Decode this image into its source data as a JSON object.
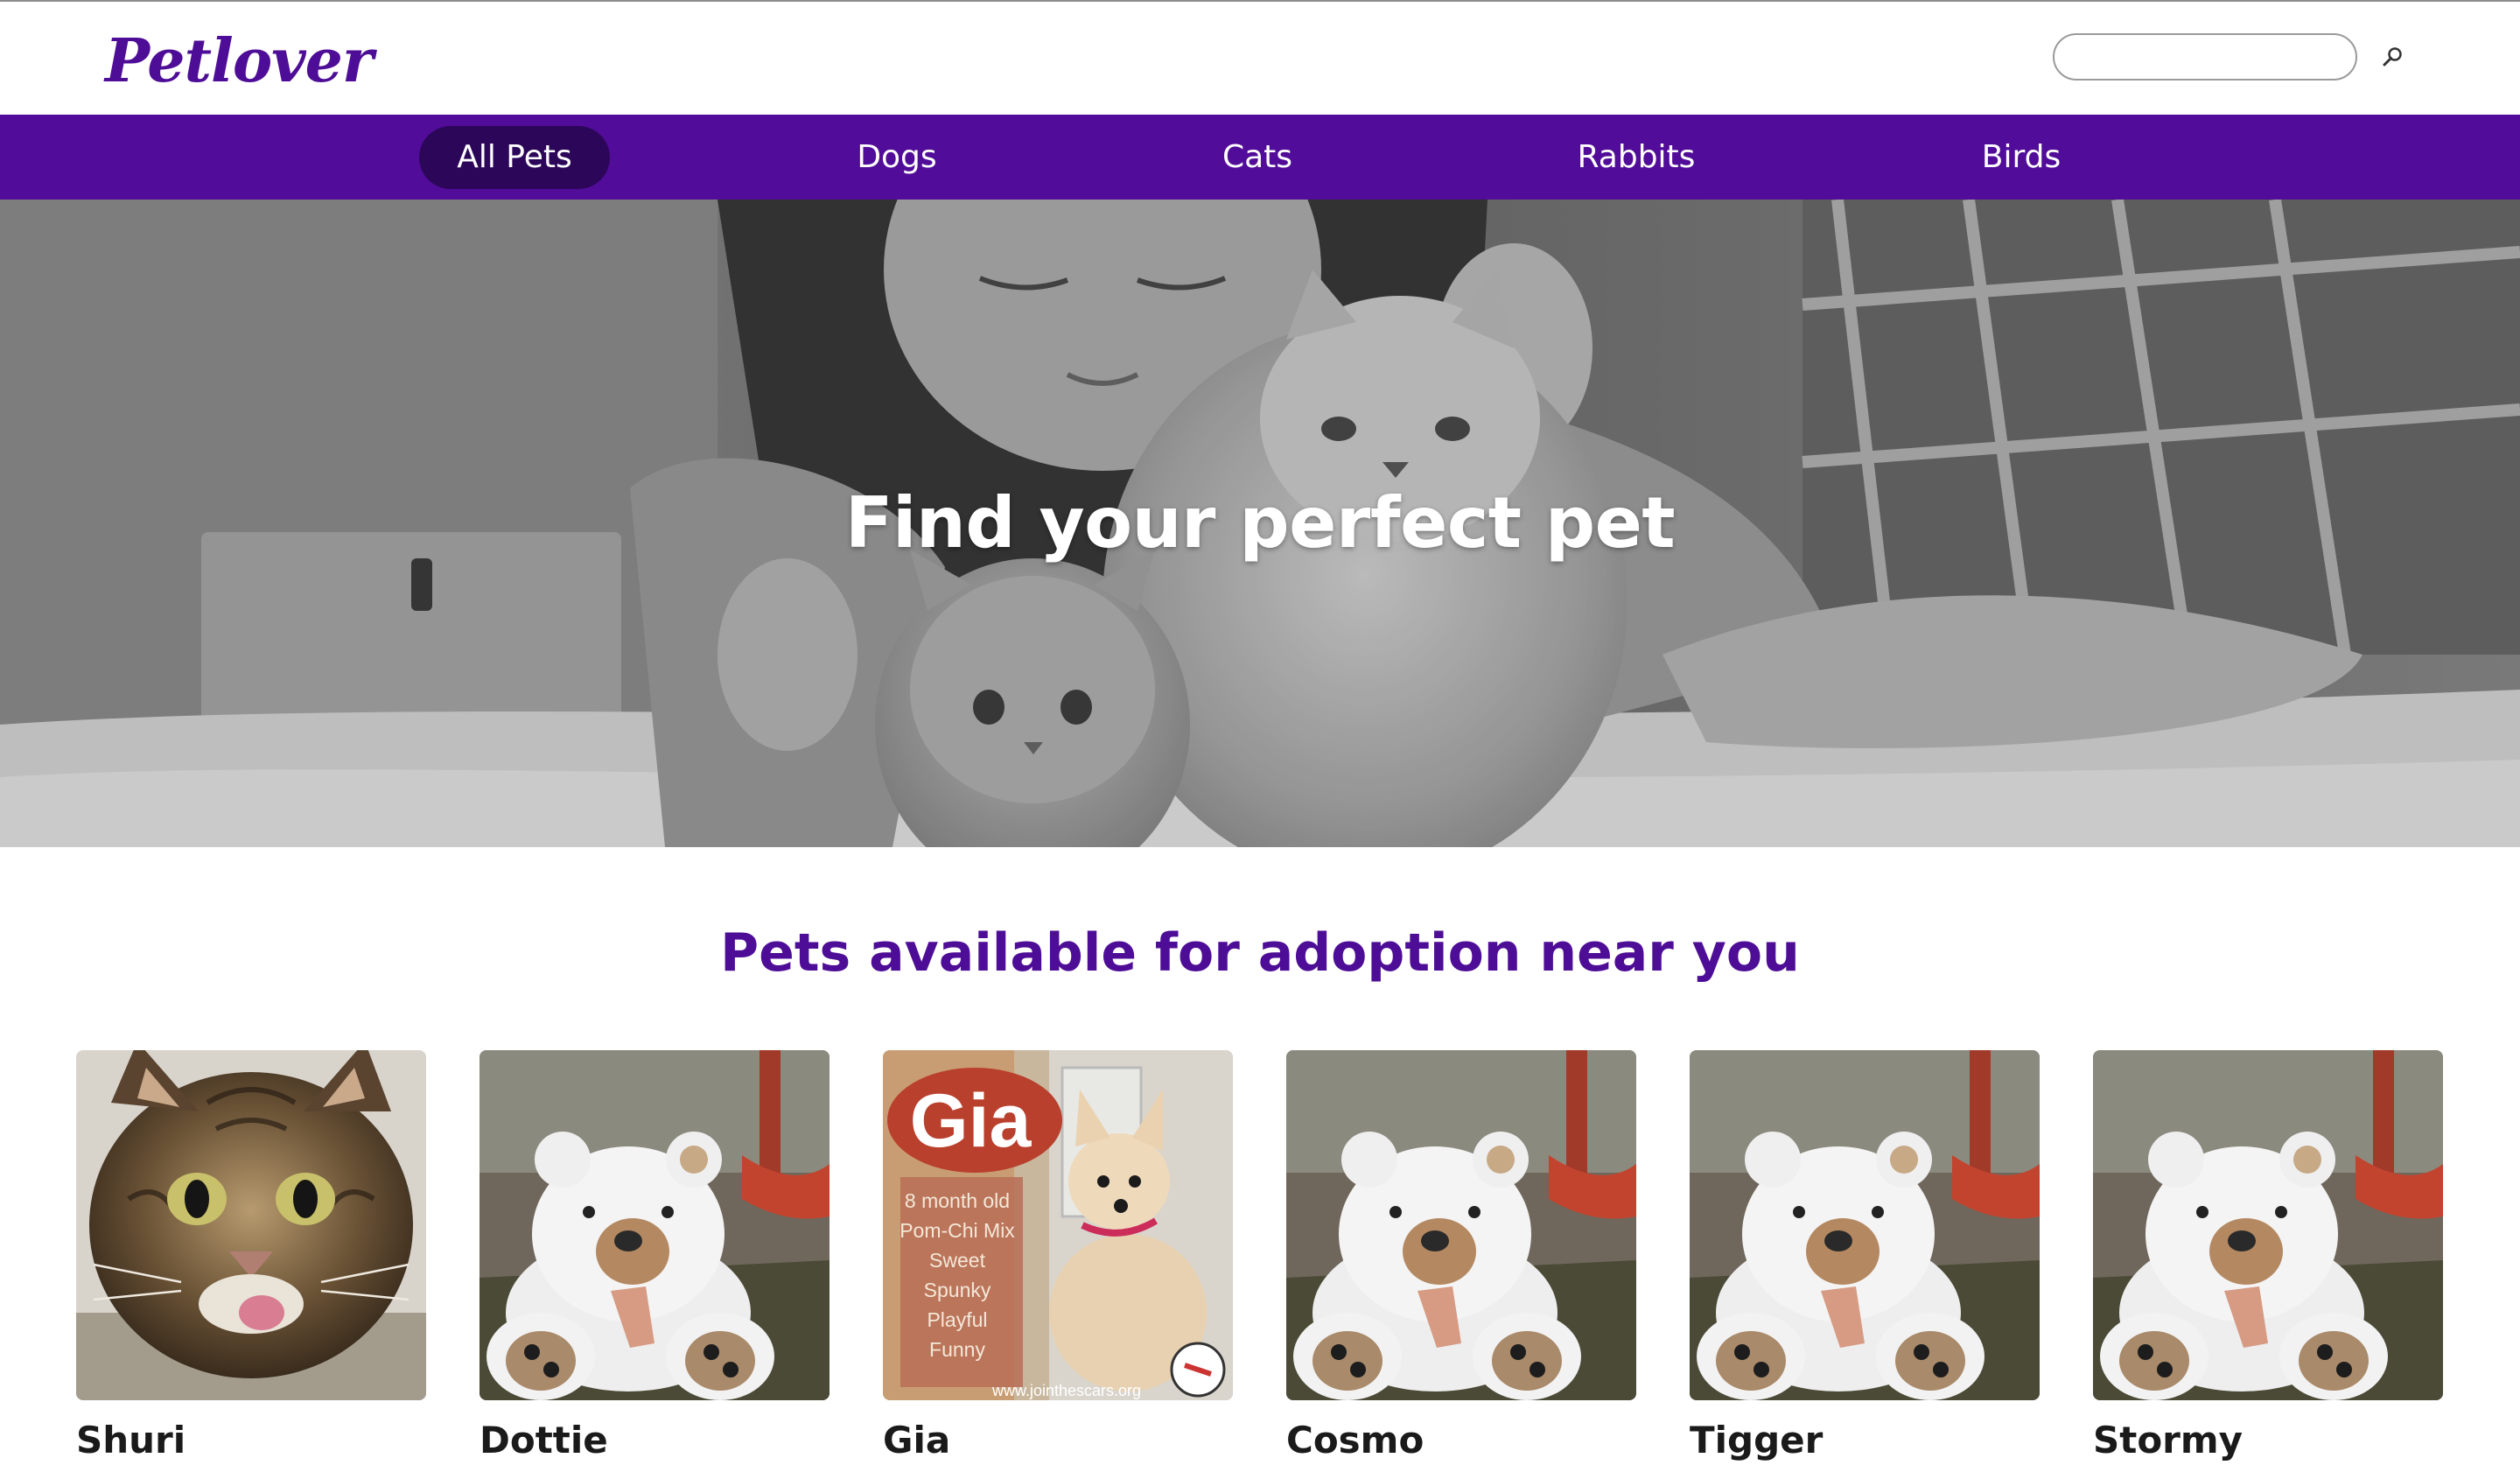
{
  "header": {
    "logo_text": "Petlover",
    "search": {
      "value": "",
      "placeholder": "",
      "icon": "search-icon"
    }
  },
  "nav": {
    "items": [
      {
        "label": "All Pets",
        "active": true
      },
      {
        "label": "Dogs",
        "active": false
      },
      {
        "label": "Cats",
        "active": false
      },
      {
        "label": "Rabbits",
        "active": false
      },
      {
        "label": "Birds",
        "active": false
      }
    ]
  },
  "hero": {
    "title": "Find your perfect pet"
  },
  "section": {
    "title": "Pets available for adoption near you"
  },
  "pets": [
    {
      "name": "Shuri",
      "photo": "tabby-cat-photo"
    },
    {
      "name": "Dottie",
      "photo": "teddy-bear-photo"
    },
    {
      "name": "Gia",
      "photo": "gia-flyer-photo",
      "flyer": {
        "name": "Gia",
        "lines": [
          "8 month old",
          "Pom-Chi Mix",
          "Sweet",
          "Spunky",
          "Playful",
          "Funny"
        ],
        "url": "www.jointhescars.org"
      }
    },
    {
      "name": "Cosmo",
      "photo": "teddy-bear-photo"
    },
    {
      "name": "Tigger",
      "photo": "teddy-bear-photo"
    },
    {
      "name": "Stormy",
      "photo": "teddy-bear-photo"
    }
  ],
  "colors": {
    "brand_purple": "#510c99",
    "nav_active": "#2c0659",
    "title_purple": "#4e0d96"
  }
}
